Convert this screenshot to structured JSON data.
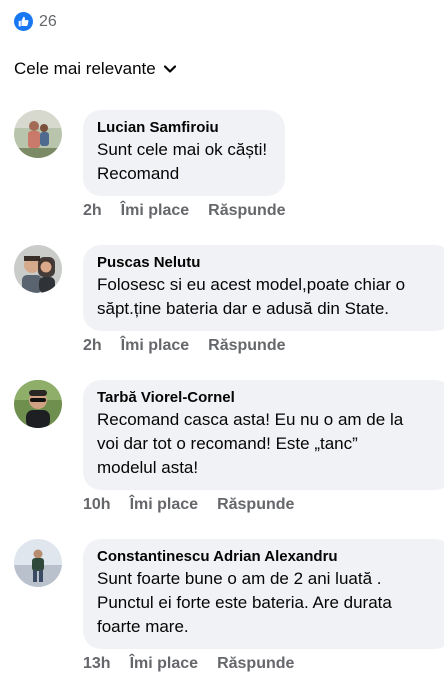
{
  "reactions": {
    "count": "26",
    "icon": "like-icon",
    "color": "#1877f2"
  },
  "sort": {
    "label": "Cele mai relevante",
    "icon": "chevron-down-icon"
  },
  "comments": [
    {
      "author": "Lucian Samfiroiu",
      "text": "Sunt cele mai ok căști!\nRecomand",
      "time": "2h",
      "like_label": "Îmi place",
      "reply_label": "Răspunde"
    },
    {
      "author": "Puscas Nelutu",
      "text": "Folosesc si eu acest model,poate chiar o\nsăpt.ține bateria dar e adusă din State.",
      "time": "2h",
      "like_label": "Îmi place",
      "reply_label": "Răspunde"
    },
    {
      "author": "Tarbă Viorel-Cornel",
      "text": "Recomand casca asta! Eu nu o am de la\nvoi dar tot o recomand! Este „tanc”\nmodelul asta!",
      "time": "10h",
      "like_label": "Îmi place",
      "reply_label": "Răspunde"
    },
    {
      "author": "Constantinescu Adrian Alexandru",
      "text": "Sunt foarte bune o am de 2 ani luată .\nPunctul ei forte este bateria. Are durata\nfoarte mare.",
      "time": "13h",
      "like_label": "Îmi place",
      "reply_label": "Răspunde"
    }
  ]
}
